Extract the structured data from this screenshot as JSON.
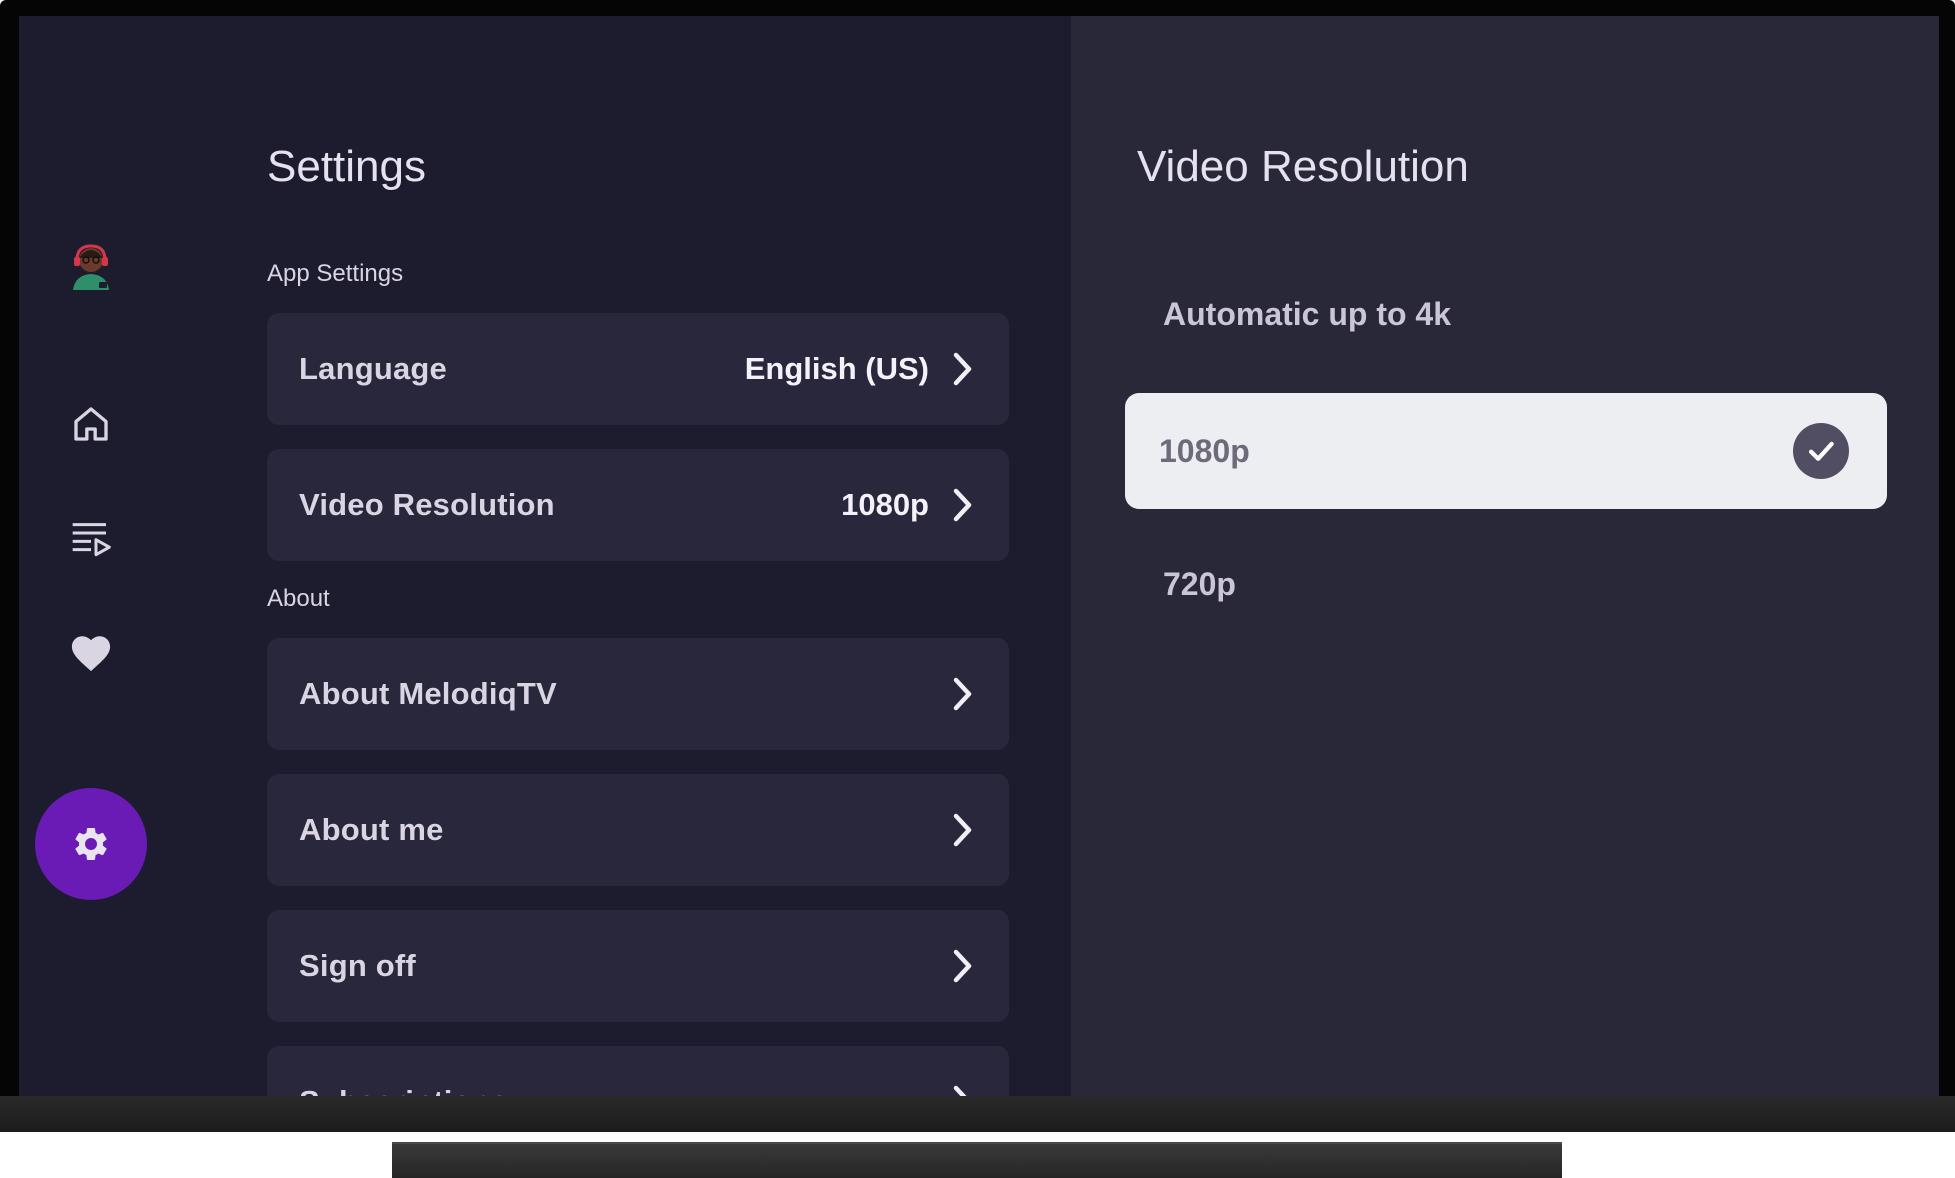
{
  "settings": {
    "title": "Settings",
    "sections": {
      "app_settings": "App Settings",
      "about": "About"
    },
    "rows": {
      "language": {
        "label": "Language",
        "value": "English (US)"
      },
      "video_resolution": {
        "label": "Video Resolution",
        "value": "1080p"
      },
      "about_app": {
        "label": "About MelodiqTV"
      },
      "about_me": {
        "label": "About me"
      },
      "sign_off": {
        "label": "Sign off"
      },
      "subscriptions": {
        "label": "Subscriptions"
      }
    }
  },
  "nav": {
    "items": [
      "avatar",
      "home-icon",
      "playlist-icon",
      "heart-icon",
      "gear-icon"
    ],
    "active": "gear-icon",
    "accent": "#6a1bb5"
  },
  "detail": {
    "title": "Video Resolution",
    "options": [
      {
        "label": "Automatic up to 4k",
        "selected": false
      },
      {
        "label": "1080p",
        "selected": true
      },
      {
        "label": "720p",
        "selected": false
      }
    ]
  }
}
